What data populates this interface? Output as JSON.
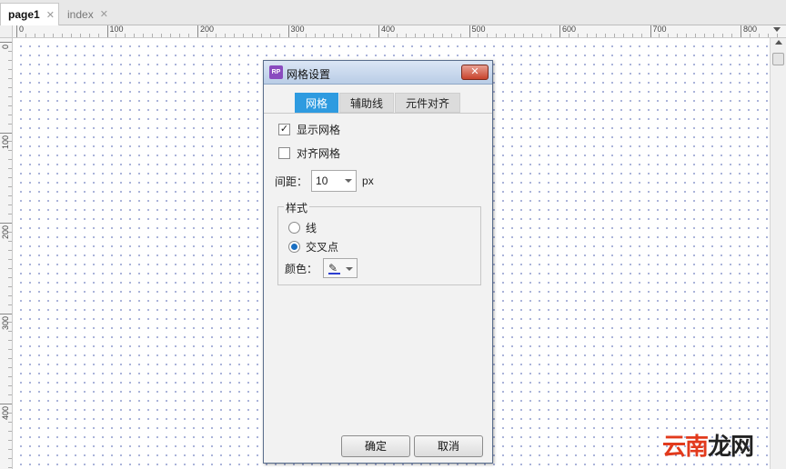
{
  "tabs": [
    {
      "label": "page1",
      "close": "✕"
    },
    {
      "label": "index",
      "close": "✕"
    }
  ],
  "ruler_top_labels": [
    "0",
    "100",
    "200",
    "300",
    "400",
    "500",
    "600",
    "700",
    "800"
  ],
  "ruler_left_labels": [
    "0",
    "100",
    "200",
    "300",
    "400"
  ],
  "dialog": {
    "title": "网格设置",
    "app_icon_text": "RP",
    "close_symbol": "✕",
    "tabs": [
      "网格",
      "辅助线",
      "元件对齐"
    ],
    "active_tab": 0,
    "show_grid": {
      "label": "显示网格",
      "checked": true,
      "mark": "✓"
    },
    "snap_grid": {
      "label": "对齐网格",
      "checked": false
    },
    "spacing": {
      "label": "间距：",
      "value": "10",
      "unit": "px"
    },
    "style_group": {
      "legend": "样式",
      "options": [
        "线",
        "交叉点"
      ],
      "selected": 1
    },
    "color": {
      "label": "颜色：",
      "value": "#2c3fd1",
      "icon": "pen-icon"
    },
    "ok_label": "确定",
    "cancel_label": "取消"
  },
  "watermark": {
    "part_a": "云南",
    "part_b": "龙网"
  }
}
